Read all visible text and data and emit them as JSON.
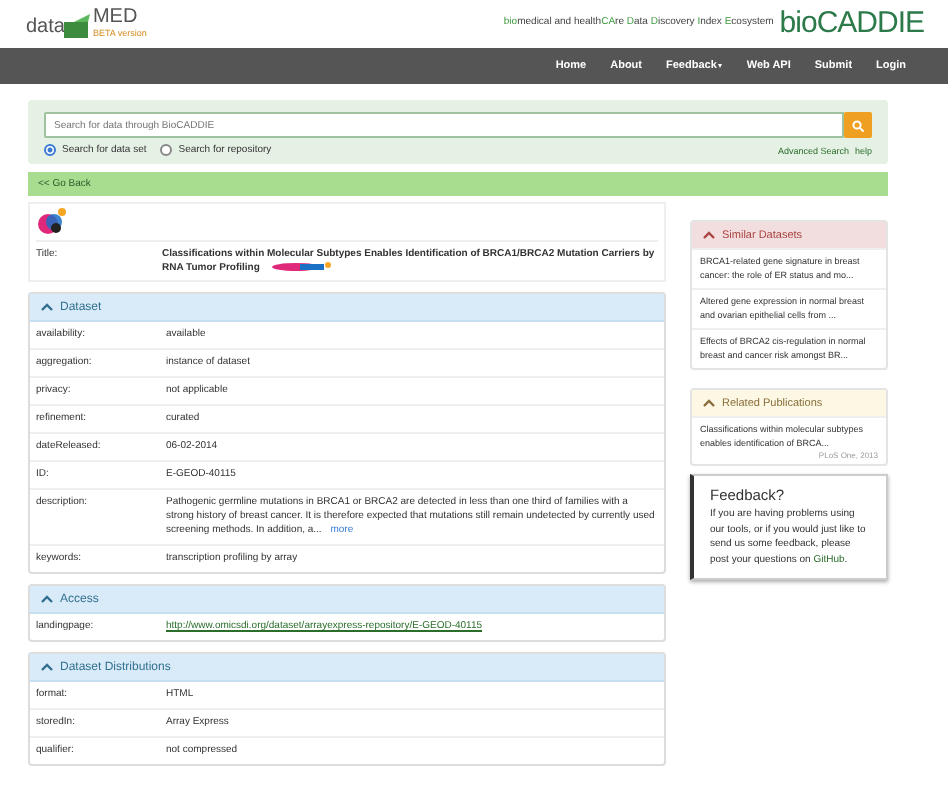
{
  "header": {
    "logo_text": "data",
    "logo_text_2": "MED",
    "logo_badge": "BETA version",
    "tagline": [
      {
        "text": "bio",
        "accent": true
      },
      {
        "text": "medical and health",
        "accent": false
      },
      {
        "text": "CA",
        "accent": true
      },
      {
        "text": "re ",
        "accent": false
      },
      {
        "text": "D",
        "accent": true
      },
      {
        "text": "ata ",
        "accent": false
      },
      {
        "text": "D",
        "accent": true
      },
      {
        "text": "iscovery ",
        "accent": false
      },
      {
        "text": "I",
        "accent": true
      },
      {
        "text": "ndex ",
        "accent": false
      },
      {
        "text": "E",
        "accent": true
      },
      {
        "text": "cosystem",
        "accent": false
      }
    ],
    "brand": "bioCADDIE"
  },
  "nav": [
    {
      "label": "Home",
      "dropdown": false
    },
    {
      "label": "About",
      "dropdown": false
    },
    {
      "label": "Feedback",
      "dropdown": true
    },
    {
      "label": "Web API",
      "dropdown": false
    },
    {
      "label": "Submit",
      "dropdown": false
    },
    {
      "label": "Login",
      "dropdown": false
    }
  ],
  "search": {
    "placeholder": "Search for data through BioCADDIE",
    "options": [
      {
        "label": "Search for data set",
        "selected": true
      },
      {
        "label": "Search for repository",
        "selected": false
      }
    ],
    "links": [
      "Advanced Search",
      "help"
    ]
  },
  "go_back": "<< Go Back",
  "title_row": {
    "label": "Title:",
    "value": "Classifications within Molecular Subtypes Enables Identification of BRCA1/BRCA2 Mutation Carriers by RNA Tumor Profiling"
  },
  "panels": [
    {
      "title": "Dataset",
      "rows": [
        {
          "label": "availability:",
          "value": "available",
          "kind": "text"
        },
        {
          "label": "aggregation:",
          "value": "instance of dataset",
          "kind": "text"
        },
        {
          "label": "privacy:",
          "value": "not applicable",
          "kind": "text"
        },
        {
          "label": "refinement:",
          "value": "curated",
          "kind": "text"
        },
        {
          "label": "dateReleased:",
          "value": "06-02-2014",
          "kind": "text"
        },
        {
          "label": "ID:",
          "value": "E-GEOD-40115",
          "kind": "text"
        },
        {
          "label": "description:",
          "value": "Pathogenic germline mutations in BRCA1 or BRCA2 are detected in less than one third of families with a strong history of breast cancer. It is therefore expected that mutations still remain undetected by currently used screening methods. In addition, a...",
          "more": "more",
          "kind": "text"
        },
        {
          "label": "keywords:",
          "value": "transcription profiling by array",
          "kind": "text"
        }
      ]
    },
    {
      "title": "Access",
      "rows": [
        {
          "label": "landingpage:",
          "value": "http://www.omicsdi.org/dataset/arrayexpress-repository/E-GEOD-40115",
          "kind": "link"
        }
      ]
    },
    {
      "title": "Dataset Distributions",
      "rows": [
        {
          "label": "format:",
          "value": "HTML",
          "kind": "text"
        },
        {
          "label": "storedIn:",
          "value": "Array Express",
          "kind": "text"
        },
        {
          "label": "qualifier:",
          "value": "not compressed",
          "kind": "text"
        }
      ]
    }
  ],
  "sidebar": {
    "similar": {
      "title": "Similar Datasets",
      "items": [
        "BRCA1-related gene signature in breast cancer: the role of ER status and mo...",
        "Altered gene expression in normal breast and ovarian epithelial cells from ...",
        "Effects of BRCA2 cis-regulation in normal breast and cancer risk amongst BR..."
      ]
    },
    "publications": {
      "title": "Related Publications",
      "items": [
        {
          "text": "Classifications within molecular subtypes enables identification of BRCA...",
          "source": "PLoS One, 2013"
        }
      ]
    },
    "feedback": {
      "title": "Feedback?",
      "text": "If you are having problems using our tools, or if you would just like to send us some feedback, please post your questions on ",
      "link": "GitHub",
      "end": "."
    }
  }
}
